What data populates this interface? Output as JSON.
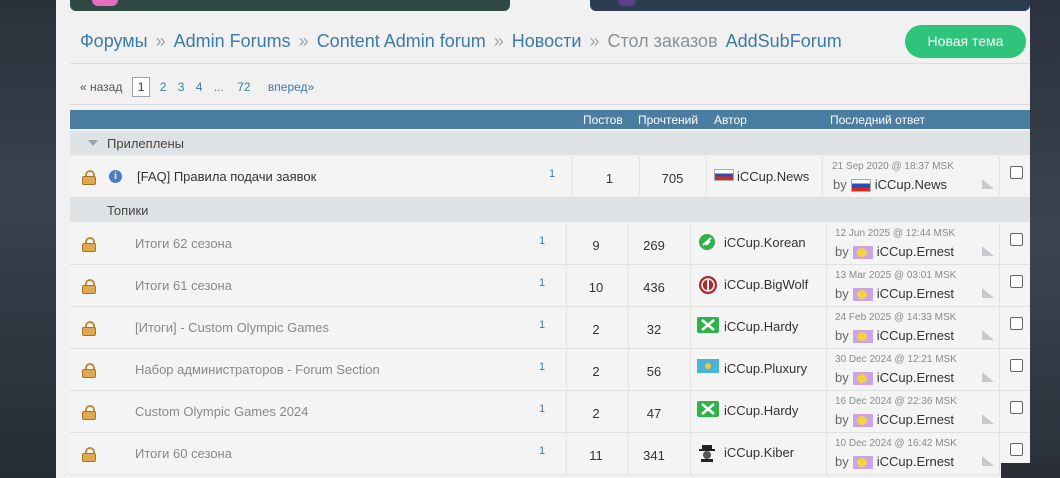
{
  "breadcrumb": {
    "items": [
      "Форумы",
      "Admin Forums",
      "Content Admin forum",
      "Новости"
    ],
    "separator": "»",
    "current": "Стол заказов",
    "subforum": "AddSubForum"
  },
  "new_topic_label": "Новая тема",
  "pager": {
    "prev": "« назад",
    "current": "1",
    "pages": [
      "2",
      "3",
      "4"
    ],
    "ellipsis": "...",
    "last": "72",
    "next": "вперед»"
  },
  "table_header": {
    "posts": "Постов",
    "views": "Прочтений",
    "author": "Автор",
    "last_reply": "Последний ответ"
  },
  "sections": {
    "pinned": "Прилеплены",
    "topics": "Топики"
  },
  "pinned_rows": [
    {
      "title": "[FAQ] Правила подачи заявок",
      "pages": "1",
      "posts": "1",
      "views": "705",
      "author": "iCCup.News",
      "last_time": "21 Sep 2020 @ 18:37 MSK",
      "last_by_prefix": "by",
      "last_user": "iCCup.News"
    }
  ],
  "topic_rows": [
    {
      "title": "Итоги 62 сезона",
      "pages": "1",
      "posts": "9",
      "views": "269",
      "author": "iCCup.Korean",
      "author_icon": "green-leaf-icon",
      "last_time": "12 Jun 2025 @ 12:44 MSK",
      "last_by_prefix": "by",
      "last_user": "iCCup.Ernest"
    },
    {
      "title": "Итоги 61 сезона",
      "pages": "1",
      "posts": "10",
      "views": "436",
      "author": "iCCup.BigWolf",
      "author_icon": "red-shield-icon",
      "last_time": "13 Mar 2025 @ 03:01 MSK",
      "last_by_prefix": "by",
      "last_user": "iCCup.Ernest"
    },
    {
      "title": "[Итоги] - Custom Olympic Games",
      "pages": "1",
      "posts": "2",
      "views": "32",
      "author": "iCCup.Hardy",
      "author_icon": "green-x-icon",
      "last_time": "24 Feb 2025 @ 14:33 MSK",
      "last_by_prefix": "by",
      "last_user": "iCCup.Ernest"
    },
    {
      "title": "Набор администраторов - Forum Section",
      "pages": "1",
      "posts": "2",
      "views": "56",
      "author": "iCCup.Pluxury",
      "author_icon": "kazakhstan-flag-icon",
      "last_time": "30 Dec 2024 @ 12:21 MSK",
      "last_by_prefix": "by",
      "last_user": "iCCup.Ernest"
    },
    {
      "title": "Custom Olympic Games 2024",
      "pages": "1",
      "posts": "2",
      "views": "47",
      "author": "iCCup.Hardy",
      "author_icon": "green-x-icon",
      "last_time": "16 Dec 2024 @ 22:36 MSK",
      "last_by_prefix": "by",
      "last_user": "iCCup.Ernest"
    },
    {
      "title": "Итоги 60 сезона",
      "pages": "1",
      "posts": "11",
      "views": "341",
      "author": "iCCup.Kiber",
      "author_icon": "spy-icon",
      "last_time": "10 Dec 2024 @ 16:42 MSK",
      "last_by_prefix": "by",
      "last_user": "iCCup.Ernest"
    }
  ],
  "colors": {
    "link": "#3c7ba8",
    "header_bg": "#4a7da0",
    "new_button": "#2ec47b"
  }
}
